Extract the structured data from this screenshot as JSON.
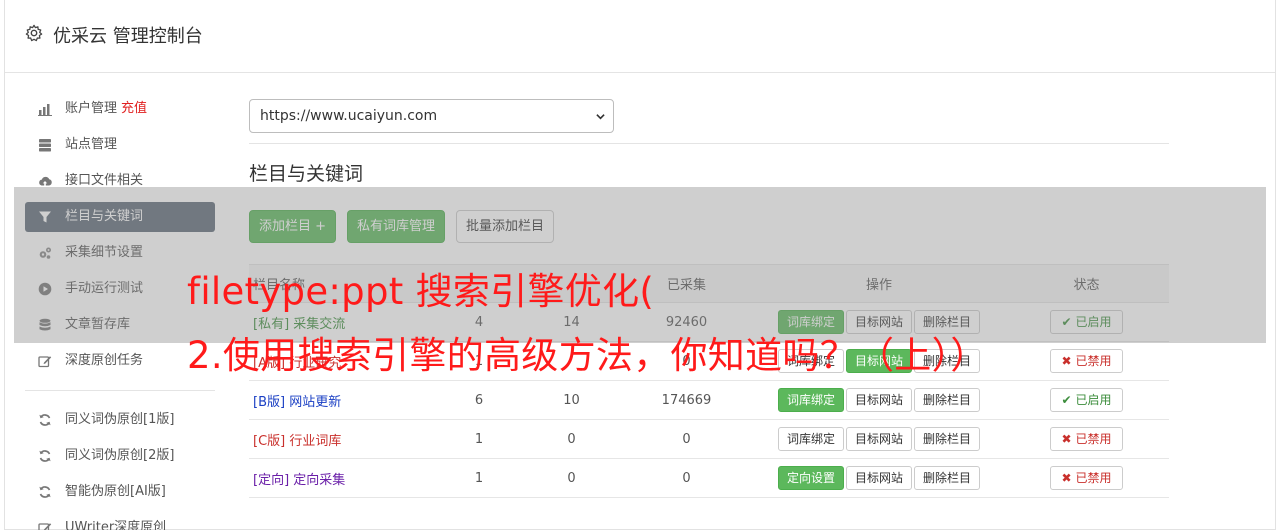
{
  "header": {
    "title": "优采云 管理控制台"
  },
  "sidebar": {
    "items": [
      {
        "label": "账户管理",
        "extra": "充值",
        "icon": "bar-chart-icon"
      },
      {
        "label": "站点管理",
        "icon": "server-icon"
      },
      {
        "label": "接口文件相关",
        "icon": "cloud-upload-icon"
      },
      {
        "label": "栏目与关键词",
        "icon": "filter-icon",
        "active": true
      },
      {
        "label": "采集细节设置",
        "icon": "cogs-icon"
      },
      {
        "label": "手动运行测试",
        "icon": "play-circle-icon"
      },
      {
        "label": "文章暂存库",
        "icon": "database-icon"
      },
      {
        "label": "深度原创任务",
        "icon": "edit-icon"
      }
    ],
    "items2": [
      {
        "label": "同义词伪原创[1版]",
        "icon": "refresh-icon"
      },
      {
        "label": "同义词伪原创[2版]",
        "icon": "refresh-icon"
      },
      {
        "label": "智能伪原创[AI版]",
        "icon": "refresh-icon"
      },
      {
        "label": "UWriter深度原创",
        "icon": "edit-icon"
      }
    ]
  },
  "main": {
    "site_select": "https://www.ucaiyun.com",
    "section_title": "栏目与关键词",
    "buttons": {
      "add": "添加栏目 +",
      "private": "私有词库管理",
      "batch": "批量添加栏目"
    },
    "table": {
      "headers": [
        "栏目名称",
        "",
        "",
        "已采集",
        "操作",
        "状态"
      ],
      "rows": [
        {
          "tag": "[私有]",
          "name": "采集交流",
          "c1": "4",
          "c2": "14",
          "c3": "92460",
          "b1": "词库绑定",
          "b1_green": true,
          "b2": "目标网站",
          "b2_green": false,
          "b3": "删除栏目",
          "status": "已启用",
          "on": true,
          "tag_color": "green"
        },
        {
          "tag": "[A版]",
          "name": "行业研究",
          "c1": "1",
          "c2": "",
          "c3": "0",
          "b1": "词库绑定",
          "b1_green": false,
          "b2": "目标网站",
          "b2_green": true,
          "b3": "删除栏目",
          "status": "已禁用",
          "on": false,
          "tag_color": "red"
        },
        {
          "tag": "[B版]",
          "name": "网站更新",
          "c1": "6",
          "c2": "10",
          "c3": "174669",
          "b1": "词库绑定",
          "b1_green": true,
          "b2": "目标网站",
          "b2_green": false,
          "b3": "删除栏目",
          "status": "已启用",
          "on": true,
          "tag_color": "blue"
        },
        {
          "tag": "[C版]",
          "name": "行业词库",
          "c1": "1",
          "c2": "0",
          "c3": "0",
          "b1": "词库绑定",
          "b1_green": false,
          "b2": "目标网站",
          "b2_green": false,
          "b3": "删除栏目",
          "status": "已禁用",
          "on": false,
          "tag_color": "red"
        },
        {
          "tag": "[定向]",
          "name": "定向采集",
          "c1": "1",
          "c2": "0",
          "c3": "0",
          "b1": "定向设置",
          "b1_green": true,
          "b2": "目标网站",
          "b2_green": false,
          "b3": "删除栏目",
          "status": "已禁用",
          "on": false,
          "tag_color": "purple"
        }
      ]
    }
  },
  "overlay": {
    "line1": "filetype:ppt 搜索引擎优化(",
    "line2": "2.使用搜索引擎的高级方法，你知道吗？（上））"
  }
}
